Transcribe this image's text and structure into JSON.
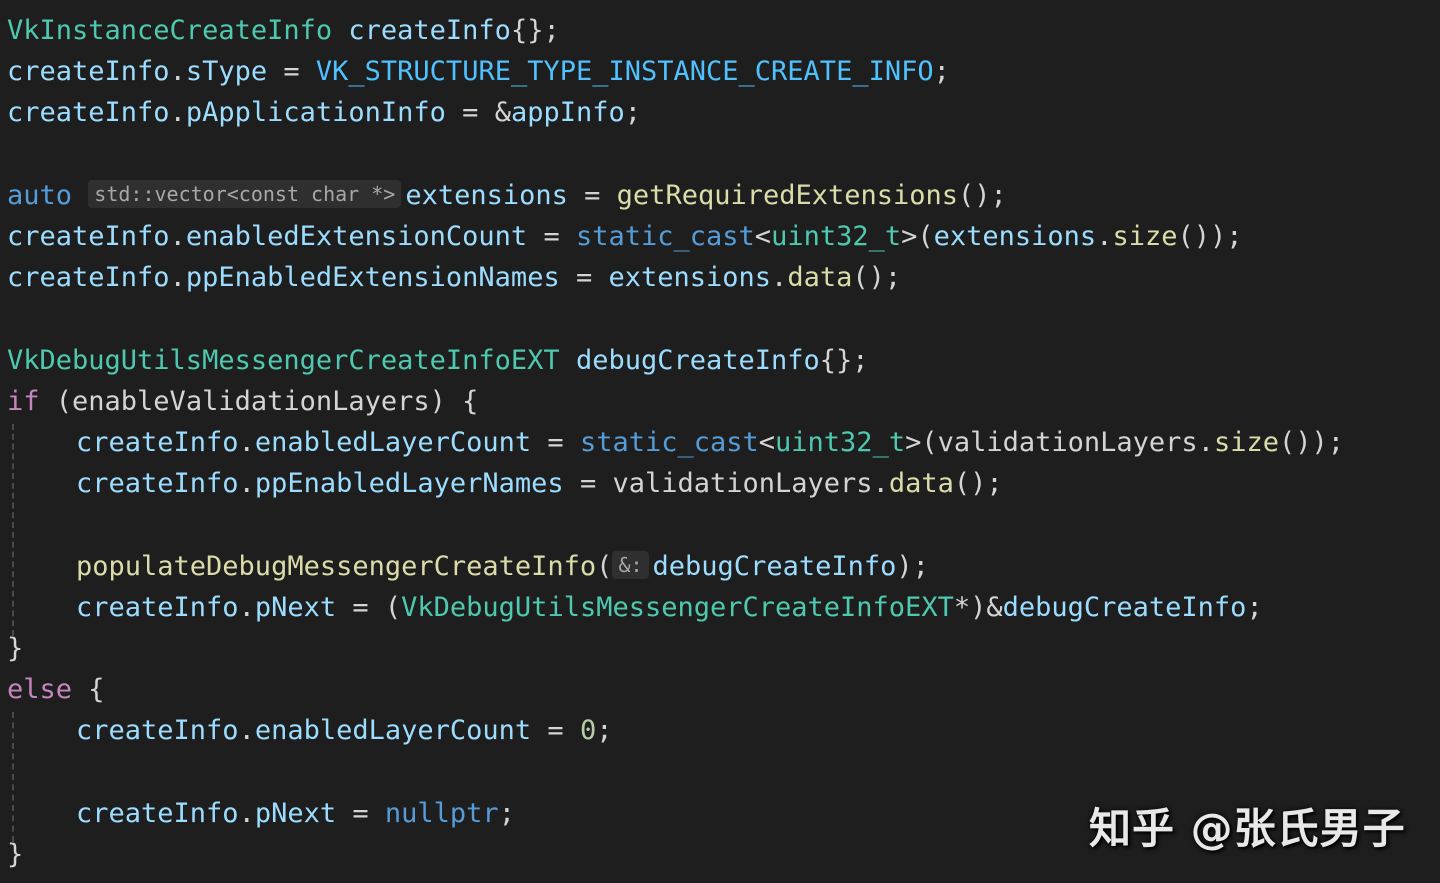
{
  "watermark": "知乎 @张氏男子",
  "lines": [
    {
      "indent": false,
      "tokens": [
        [
          "type",
          "VkInstanceCreateInfo"
        ],
        [
          "plain",
          " "
        ],
        [
          "var",
          "createInfo"
        ],
        [
          "punc",
          "{};"
        ]
      ]
    },
    {
      "indent": false,
      "tokens": [
        [
          "var",
          "createInfo"
        ],
        [
          "punc",
          "."
        ],
        [
          "var",
          "sType"
        ],
        [
          "op",
          " = "
        ],
        [
          "enum",
          "VK_STRUCTURE_TYPE_INSTANCE_CREATE_INFO"
        ],
        [
          "punc",
          ";"
        ]
      ]
    },
    {
      "indent": false,
      "tokens": [
        [
          "var",
          "createInfo"
        ],
        [
          "punc",
          "."
        ],
        [
          "var",
          "pApplicationInfo"
        ],
        [
          "op",
          " = &"
        ],
        [
          "var",
          "appInfo"
        ],
        [
          "punc",
          ";"
        ]
      ]
    },
    {
      "indent": false,
      "tokens": []
    },
    {
      "indent": false,
      "tokens": [
        [
          "kw",
          "auto"
        ],
        [
          "plain",
          " "
        ],
        [
          "hint",
          "std::vector<const char *>"
        ],
        [
          "var",
          "extensions"
        ],
        [
          "op",
          " = "
        ],
        [
          "fn",
          "getRequiredExtensions"
        ],
        [
          "punc",
          "();"
        ]
      ]
    },
    {
      "indent": false,
      "tokens": [
        [
          "var",
          "createInfo"
        ],
        [
          "punc",
          "."
        ],
        [
          "var",
          "enabledExtensionCount"
        ],
        [
          "op",
          " = "
        ],
        [
          "kw",
          "static_cast"
        ],
        [
          "punc",
          "<"
        ],
        [
          "type",
          "uint32_t"
        ],
        [
          "punc",
          ">("
        ],
        [
          "var",
          "extensions"
        ],
        [
          "punc",
          "."
        ],
        [
          "fn",
          "size"
        ],
        [
          "punc",
          "());"
        ]
      ]
    },
    {
      "indent": false,
      "tokens": [
        [
          "var",
          "createInfo"
        ],
        [
          "punc",
          "."
        ],
        [
          "var",
          "ppEnabledExtensionNames"
        ],
        [
          "op",
          " = "
        ],
        [
          "var",
          "extensions"
        ],
        [
          "punc",
          "."
        ],
        [
          "fn",
          "data"
        ],
        [
          "punc",
          "();"
        ]
      ]
    },
    {
      "indent": false,
      "tokens": []
    },
    {
      "indent": false,
      "tokens": [
        [
          "type",
          "VkDebugUtilsMessengerCreateInfoEXT"
        ],
        [
          "plain",
          " "
        ],
        [
          "var",
          "debugCreateInfo"
        ],
        [
          "punc",
          "{};"
        ]
      ]
    },
    {
      "indent": false,
      "tokens": [
        [
          "ctrl",
          "if"
        ],
        [
          "plain",
          " (enableValidationLayers) {"
        ]
      ]
    },
    {
      "indent": true,
      "tokens": [
        [
          "var",
          "createInfo"
        ],
        [
          "punc",
          "."
        ],
        [
          "var",
          "enabledLayerCount"
        ],
        [
          "op",
          " = "
        ],
        [
          "kw",
          "static_cast"
        ],
        [
          "punc",
          "<"
        ],
        [
          "type",
          "uint32_t"
        ],
        [
          "punc",
          ">("
        ],
        [
          "plain",
          "validationLayers"
        ],
        [
          "punc",
          "."
        ],
        [
          "fn",
          "size"
        ],
        [
          "punc",
          "());"
        ]
      ]
    },
    {
      "indent": true,
      "tokens": [
        [
          "var",
          "createInfo"
        ],
        [
          "punc",
          "."
        ],
        [
          "var",
          "ppEnabledLayerNames"
        ],
        [
          "op",
          " = "
        ],
        [
          "plain",
          "validationLayers"
        ],
        [
          "punc",
          "."
        ],
        [
          "fn",
          "data"
        ],
        [
          "punc",
          "();"
        ]
      ]
    },
    {
      "indent": true,
      "tokens": []
    },
    {
      "indent": true,
      "tokens": [
        [
          "fn",
          "populateDebugMessengerCreateInfo"
        ],
        [
          "punc",
          "("
        ],
        [
          "hint",
          "&:"
        ],
        [
          "var",
          "debugCreateInfo"
        ],
        [
          "punc",
          ");"
        ]
      ]
    },
    {
      "indent": true,
      "tokens": [
        [
          "var",
          "createInfo"
        ],
        [
          "punc",
          "."
        ],
        [
          "var",
          "pNext"
        ],
        [
          "op",
          " = ("
        ],
        [
          "type",
          "VkDebugUtilsMessengerCreateInfoEXT"
        ],
        [
          "punc",
          "*)&"
        ],
        [
          "var",
          "debugCreateInfo"
        ],
        [
          "punc",
          ";"
        ]
      ]
    },
    {
      "indent": false,
      "tokens": [
        [
          "punc",
          "}"
        ]
      ]
    },
    {
      "indent": false,
      "tokens": [
        [
          "ctrl",
          "else"
        ],
        [
          "plain",
          " {"
        ]
      ]
    },
    {
      "indent": true,
      "tokens": [
        [
          "var",
          "createInfo"
        ],
        [
          "punc",
          "."
        ],
        [
          "var",
          "enabledLayerCount"
        ],
        [
          "op",
          " = "
        ],
        [
          "num",
          "0"
        ],
        [
          "punc",
          ";"
        ]
      ]
    },
    {
      "indent": true,
      "tokens": []
    },
    {
      "indent": true,
      "tokens": [
        [
          "var",
          "createInfo"
        ],
        [
          "punc",
          "."
        ],
        [
          "var",
          "pNext"
        ],
        [
          "op",
          " = "
        ],
        [
          "kw",
          "nullptr"
        ],
        [
          "punc",
          ";"
        ]
      ]
    },
    {
      "indent": false,
      "tokens": [
        [
          "punc",
          "}"
        ]
      ]
    }
  ]
}
